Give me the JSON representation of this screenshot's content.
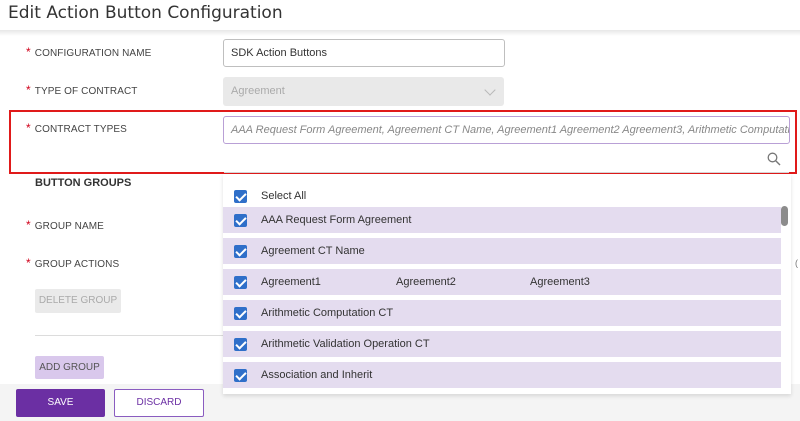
{
  "page": {
    "title": "Edit Action Button Configuration"
  },
  "form": {
    "config_name": {
      "label": "CONFIGURATION NAME",
      "value": "SDK Action Buttons"
    },
    "type_of_contract": {
      "label": "TYPE OF CONTRACT",
      "value": "Agreement"
    },
    "contract_types": {
      "label": "CONTRACT TYPES",
      "value": "AAA Request Form Agreement, Agreement CT Name, Agreement1 Agreement2 Agreement3, Arithmetic Computation…"
    },
    "required_marker": "*"
  },
  "dropdown": {
    "options": [
      {
        "label": "Select All",
        "checked": true,
        "selected_bg": false
      },
      {
        "label": "AAA Request Form Agreement",
        "checked": true,
        "selected_bg": true
      },
      {
        "label": "Agreement CT Name",
        "checked": true,
        "selected_bg": true
      },
      {
        "label": "Agreement1",
        "label2": "Agreement2",
        "label3": "Agreement3",
        "checked": true,
        "selected_bg": true
      },
      {
        "label": "Arithmetic Computation CT",
        "checked": true,
        "selected_bg": true
      },
      {
        "label": "Arithmetic Validation Operation CT",
        "checked": true,
        "selected_bg": true
      },
      {
        "label": "Association and Inherit",
        "checked": true,
        "selected_bg": true
      }
    ]
  },
  "button_groups": {
    "title": "BUTTON GROUPS",
    "group_name_label": "GROUP NAME",
    "group_actions_label": "GROUP ACTIONS",
    "delete_label": "DELETE GROUP",
    "add_label": "ADD GROUP"
  },
  "footer": {
    "save_label": "SAVE",
    "discard_label": "DISCARD"
  },
  "colors": {
    "primary": "#6b2fa3",
    "selected_row": "#e4dcef",
    "checkbox": "#2f6fc9",
    "required": "#d0021b",
    "highlight_border": "#e01a1a"
  },
  "icons": {
    "search": "search-icon",
    "chevron": "chevron-down-icon",
    "checkbox": "checkbox-checked-icon"
  }
}
